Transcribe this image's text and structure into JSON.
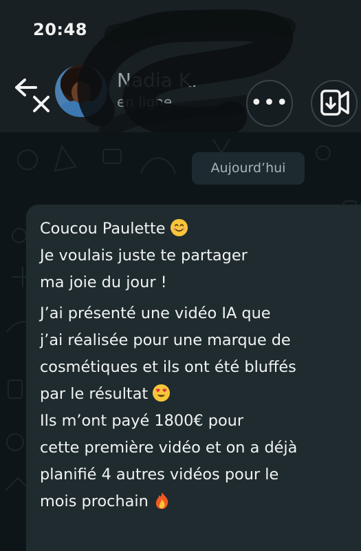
{
  "status_bar": {
    "time": "20:48"
  },
  "header": {
    "contact_name": "Nadia K.",
    "contact_status": "en ligne",
    "icons": [
      "back-close-icon",
      "avatar",
      "more-dots-icon",
      "video-call-icon"
    ],
    "more_label": "•••"
  },
  "chat": {
    "date_chip": "Aujourd’hui",
    "message": {
      "lines": [
        "Coucou Paulette",
        "Je voulais juste te partager",
        "ma joie du jour !",
        "J’ai présenté une vidéo IA que",
        "j’ai réalisée pour une marque de",
        "cosmétiques et ils ont été bluffés",
        "par le résultat",
        "Ils m’ont payé 1800€ pour",
        "cette première vidéo et on a déjà",
        "planifié 4 autres vidéos pour le",
        "mois prochain"
      ],
      "emojis": [
        "smiling-face-emoji",
        "heart-eyes-emoji",
        "fire-emoji"
      ]
    }
  },
  "colors": {
    "background": "#0e1518",
    "header": "#182024",
    "bubble": "#1f2b2f",
    "text": "#f1f3f3",
    "chip": "#1d2a30"
  }
}
